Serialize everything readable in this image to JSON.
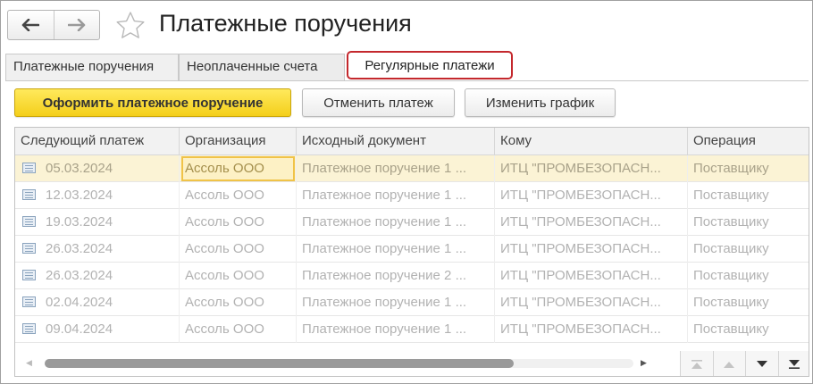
{
  "header": {
    "title": "Платежные поручения",
    "back_icon": "arrow-left-icon",
    "forward_icon": "arrow-right-icon",
    "favorite_icon": "star-icon"
  },
  "tabs": [
    {
      "label": "Платежные поручения"
    },
    {
      "label": "Неоплаченные счета"
    },
    {
      "label": "Регулярные платежи"
    }
  ],
  "toolbar": {
    "create_label": "Оформить платежное поручение",
    "cancel_label": "Отменить платеж",
    "schedule_label": "Изменить график"
  },
  "table": {
    "columns": [
      "Следующий платеж",
      "Организация",
      "Исходный документ",
      "Кому",
      "Операция"
    ],
    "rows": [
      {
        "date": "05.03.2024",
        "org": "Ассоль ООО",
        "doc": "Платежное поручение 1 ...",
        "to": "ИТЦ \"ПРОМБЕЗОПАСН...",
        "op": "Поставщику"
      },
      {
        "date": "12.03.2024",
        "org": "Ассоль ООО",
        "doc": "Платежное поручение 1 ...",
        "to": "ИТЦ \"ПРОМБЕЗОПАСН...",
        "op": "Поставщику"
      },
      {
        "date": "19.03.2024",
        "org": "Ассоль ООО",
        "doc": "Платежное поручение 1 ...",
        "to": "ИТЦ \"ПРОМБЕЗОПАСН...",
        "op": "Поставщику"
      },
      {
        "date": "26.03.2024",
        "org": "Ассоль ООО",
        "doc": "Платежное поручение 1 ...",
        "to": "ИТЦ \"ПРОМБЕЗОПАСН...",
        "op": "Поставщику"
      },
      {
        "date": "26.03.2024",
        "org": "Ассоль ООО",
        "doc": "Платежное поручение 2 ...",
        "to": "ИТЦ \"ПРОМБЕЗОПАСН...",
        "op": "Поставщику"
      },
      {
        "date": "02.04.2024",
        "org": "Ассоль ООО",
        "doc": "Платежное поручение 1 ...",
        "to": "ИТЦ \"ПРОМБЕЗОПАСН...",
        "op": "Поставщику"
      },
      {
        "date": "09.04.2024",
        "org": "Ассоль ООО",
        "doc": "Платежное поручение 1 ...",
        "to": "ИТЦ \"ПРОМБЕЗОПАСН...",
        "op": "Поставщику"
      }
    ],
    "selected_row": 0
  },
  "colors": {
    "accent_yellow": "#f4cf1a",
    "active_tab_border": "#c4282d",
    "selection": "#fbf3d5"
  }
}
